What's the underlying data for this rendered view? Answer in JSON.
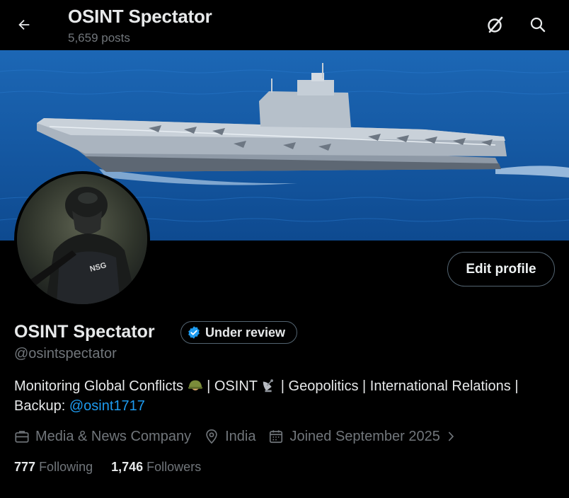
{
  "header": {
    "title": "OSINT Spectator",
    "post_count": "5,659 posts",
    "back_icon": "arrow-left-icon",
    "grok_icon": "grok-icon",
    "search_icon": "search-icon"
  },
  "profile": {
    "name": "OSINT Spectator",
    "verification_badge": "Under review",
    "handle": "@osintspectator",
    "edit_button": "Edit profile",
    "bio": {
      "part1": "Monitoring Global Conflicts",
      "part2": "| OSINT",
      "part3": "| Geopolitics | International Relations | Backup:",
      "link": "@osint1717"
    },
    "meta": {
      "category": "Media & News Company",
      "location": "India",
      "joined": "Joined September 2025"
    },
    "stats": {
      "following_count": "777",
      "following_label": "Following",
      "followers_count": "1,746",
      "followers_label": "Followers"
    },
    "avatar_text": "NSG"
  },
  "colors": {
    "background": "#000000",
    "text_primary": "#e7e9ea",
    "text_secondary": "#71767b",
    "link": "#1d9bf0",
    "border": "#536471",
    "verified": "#1d9bf0"
  }
}
